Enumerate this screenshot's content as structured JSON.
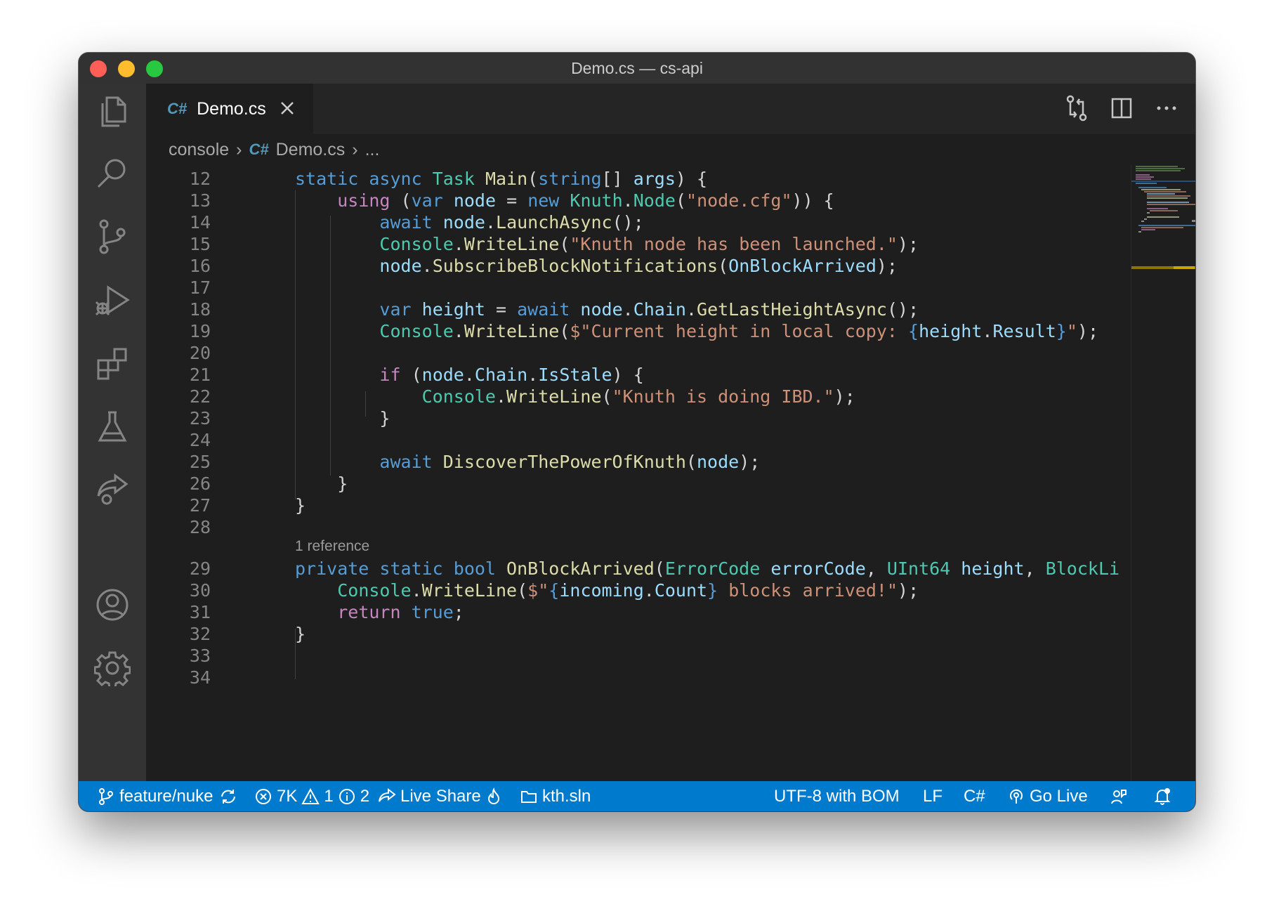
{
  "window": {
    "title": "Demo.cs — cs-api"
  },
  "activity_bar": {
    "items": [
      "files-icon",
      "search-icon",
      "source-control-icon",
      "run-debug-icon",
      "extensions-icon",
      "testing-icon",
      "live-share-icon",
      "account-icon",
      "settings-gear-icon"
    ]
  },
  "tab": {
    "icon_text": "C#",
    "label": "Demo.cs"
  },
  "breadcrumb": {
    "folder": "console",
    "file_icon": "C#",
    "file": "Demo.cs",
    "more": "..."
  },
  "editor": {
    "codelens": "1 reference",
    "lines": [
      {
        "n": "12",
        "tokens": [
          [
            "static ",
            "kw"
          ],
          [
            "async ",
            "kw"
          ],
          [
            "Task ",
            "ty"
          ],
          [
            "Main",
            "fn"
          ],
          [
            "(",
            "pn"
          ],
          [
            "string",
            "kw"
          ],
          [
            "[] ",
            "pn"
          ],
          [
            "args",
            "var"
          ],
          [
            ") {",
            "pn"
          ]
        ]
      },
      {
        "n": "13",
        "tokens": [
          [
            "    ",
            "pn"
          ],
          [
            "using ",
            "ctl"
          ],
          [
            "(",
            "pn"
          ],
          [
            "var ",
            "kw"
          ],
          [
            "node",
            "var"
          ],
          [
            " = ",
            "pn"
          ],
          [
            "new ",
            "kw"
          ],
          [
            "Knuth",
            "ty"
          ],
          [
            ".",
            "pn"
          ],
          [
            "Node",
            "ty"
          ],
          [
            "(",
            "pn"
          ],
          [
            "\"node.cfg\"",
            "str"
          ],
          [
            ")) {",
            "pn"
          ]
        ]
      },
      {
        "n": "14",
        "tokens": [
          [
            "        ",
            "pn"
          ],
          [
            "await ",
            "kw"
          ],
          [
            "node",
            "var"
          ],
          [
            ".",
            "pn"
          ],
          [
            "LaunchAsync",
            "fn"
          ],
          [
            "();",
            "pn"
          ]
        ]
      },
      {
        "n": "15",
        "tokens": [
          [
            "        ",
            "pn"
          ],
          [
            "Console",
            "ty"
          ],
          [
            ".",
            "pn"
          ],
          [
            "WriteLine",
            "fn"
          ],
          [
            "(",
            "pn"
          ],
          [
            "\"Knuth node has been launched.\"",
            "str"
          ],
          [
            ");",
            "pn"
          ]
        ]
      },
      {
        "n": "16",
        "tokens": [
          [
            "        ",
            "pn"
          ],
          [
            "node",
            "var"
          ],
          [
            ".",
            "pn"
          ],
          [
            "SubscribeBlockNotifications",
            "fn"
          ],
          [
            "(",
            "pn"
          ],
          [
            "OnBlockArrived",
            "var"
          ],
          [
            ");",
            "pn"
          ]
        ]
      },
      {
        "n": "17",
        "tokens": []
      },
      {
        "n": "18",
        "tokens": [
          [
            "        ",
            "pn"
          ],
          [
            "var ",
            "kw"
          ],
          [
            "height",
            "var"
          ],
          [
            " = ",
            "pn"
          ],
          [
            "await ",
            "kw"
          ],
          [
            "node",
            "var"
          ],
          [
            ".",
            "pn"
          ],
          [
            "Chain",
            "var"
          ],
          [
            ".",
            "pn"
          ],
          [
            "GetLastHeightAsync",
            "fn"
          ],
          [
            "();",
            "pn"
          ]
        ]
      },
      {
        "n": "19",
        "tokens": [
          [
            "        ",
            "pn"
          ],
          [
            "Console",
            "ty"
          ],
          [
            ".",
            "pn"
          ],
          [
            "WriteLine",
            "fn"
          ],
          [
            "(",
            "pn"
          ],
          [
            "$\"Current height in local copy: ",
            "str"
          ],
          [
            "{",
            "kw"
          ],
          [
            "height",
            "var"
          ],
          [
            ".",
            "pn"
          ],
          [
            "Result",
            "var"
          ],
          [
            "}",
            "kw"
          ],
          [
            "\"",
            "str"
          ],
          [
            ");",
            "pn"
          ]
        ]
      },
      {
        "n": "20",
        "tokens": []
      },
      {
        "n": "21",
        "tokens": [
          [
            "        ",
            "pn"
          ],
          [
            "if ",
            "ctl"
          ],
          [
            "(",
            "pn"
          ],
          [
            "node",
            "var"
          ],
          [
            ".",
            "pn"
          ],
          [
            "Chain",
            "var"
          ],
          [
            ".",
            "pn"
          ],
          [
            "IsStale",
            "var"
          ],
          [
            ") {",
            "pn"
          ]
        ]
      },
      {
        "n": "22",
        "tokens": [
          [
            "            ",
            "pn"
          ],
          [
            "Console",
            "ty"
          ],
          [
            ".",
            "pn"
          ],
          [
            "WriteLine",
            "fn"
          ],
          [
            "(",
            "pn"
          ],
          [
            "\"Knuth is doing IBD.\"",
            "str"
          ],
          [
            ");",
            "pn"
          ]
        ]
      },
      {
        "n": "23",
        "tokens": [
          [
            "        }",
            "pn"
          ]
        ]
      },
      {
        "n": "24",
        "tokens": []
      },
      {
        "n": "25",
        "tokens": [
          [
            "        ",
            "pn"
          ],
          [
            "await ",
            "kw"
          ],
          [
            "DiscoverThePowerOfKnuth",
            "fn"
          ],
          [
            "(",
            "pn"
          ],
          [
            "node",
            "var"
          ],
          [
            ");",
            "pn"
          ]
        ]
      },
      {
        "n": "26",
        "tokens": [
          [
            "    }",
            "pn"
          ]
        ]
      },
      {
        "n": "27",
        "tokens": [
          [
            "}",
            "pn"
          ]
        ]
      },
      {
        "n": "28",
        "tokens": []
      },
      {
        "n": "29",
        "tokens": [
          [
            "private ",
            "kw"
          ],
          [
            "static ",
            "kw"
          ],
          [
            "bool ",
            "kw"
          ],
          [
            "OnBlockArrived",
            "fn"
          ],
          [
            "(",
            "pn"
          ],
          [
            "ErrorCode ",
            "ty"
          ],
          [
            "errorCode",
            "var"
          ],
          [
            ", ",
            "pn"
          ],
          [
            "UInt64 ",
            "ty"
          ],
          [
            "height",
            "var"
          ],
          [
            ", ",
            "pn"
          ],
          [
            "BlockLi",
            "ty"
          ]
        ]
      },
      {
        "n": "30",
        "tokens": [
          [
            "    ",
            "pn"
          ],
          [
            "Console",
            "ty"
          ],
          [
            ".",
            "pn"
          ],
          [
            "WriteLine",
            "fn"
          ],
          [
            "(",
            "pn"
          ],
          [
            "$\"",
            "str"
          ],
          [
            "{",
            "kw"
          ],
          [
            "incoming",
            "var"
          ],
          [
            ".",
            "pn"
          ],
          [
            "Count",
            "var"
          ],
          [
            "}",
            "kw"
          ],
          [
            " blocks arrived!\"",
            "str"
          ],
          [
            ");",
            "pn"
          ]
        ]
      },
      {
        "n": "31",
        "tokens": [
          [
            "    ",
            "pn"
          ],
          [
            "return ",
            "ctl"
          ],
          [
            "true",
            "kw"
          ],
          [
            ";",
            "pn"
          ]
        ]
      },
      {
        "n": "32",
        "tokens": [
          [
            "}",
            "pn"
          ]
        ]
      },
      {
        "n": "33",
        "tokens": []
      },
      {
        "n": "34",
        "tokens": []
      }
    ]
  },
  "status": {
    "branch": "feature/nuke",
    "errors": "7K",
    "warnings": "1",
    "infos": "2",
    "live_share": "Live Share",
    "solution": "kth.sln",
    "encoding": "UTF-8 with BOM",
    "eol": "LF",
    "language": "C#",
    "go_live": "Go Live"
  },
  "colors": {
    "accent": "#007acc",
    "keyword": "#569cd6",
    "control": "#c586c0",
    "type": "#4ec9b0",
    "function": "#dcdcaa",
    "string": "#ce9178",
    "variable": "#9cdcfe"
  }
}
